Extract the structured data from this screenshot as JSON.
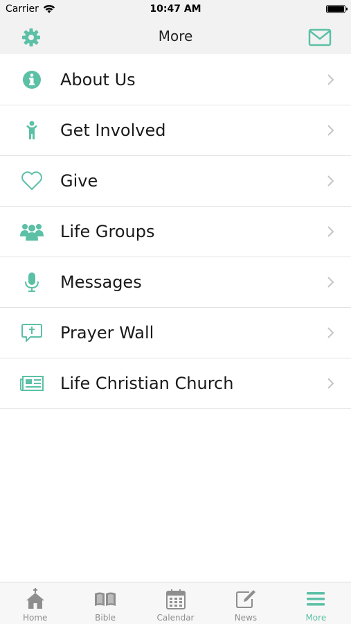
{
  "theme": {
    "accent": "#5cc0a6",
    "inactive": "#8e8e8e",
    "bar_bg": "#f2f2f2"
  },
  "status_bar": {
    "carrier": "Carrier",
    "time": "10:47 AM",
    "icons": [
      "wifi-icon",
      "battery-icon"
    ]
  },
  "nav": {
    "title": "More",
    "left_icon": "gear-icon",
    "right_icon": "envelope-icon"
  },
  "menu": {
    "items": [
      {
        "label": "About Us",
        "icon": "info-circle-icon"
      },
      {
        "label": "Get Involved",
        "icon": "person-icon"
      },
      {
        "label": "Give",
        "icon": "heart-icon"
      },
      {
        "label": "Life Groups",
        "icon": "group-icon"
      },
      {
        "label": "Messages",
        "icon": "microphone-icon"
      },
      {
        "label": "Prayer Wall",
        "icon": "prayer-bubble-icon"
      },
      {
        "label": "Life Christian Church",
        "icon": "newspaper-icon"
      }
    ]
  },
  "tab_bar": {
    "tabs": [
      {
        "label": "Home",
        "icon": "church-icon",
        "active": false
      },
      {
        "label": "Bible",
        "icon": "book-icon",
        "active": false
      },
      {
        "label": "Calendar",
        "icon": "calendar-icon",
        "active": false
      },
      {
        "label": "News",
        "icon": "edit-icon",
        "active": false
      },
      {
        "label": "More",
        "icon": "menu-icon",
        "active": true
      }
    ]
  }
}
